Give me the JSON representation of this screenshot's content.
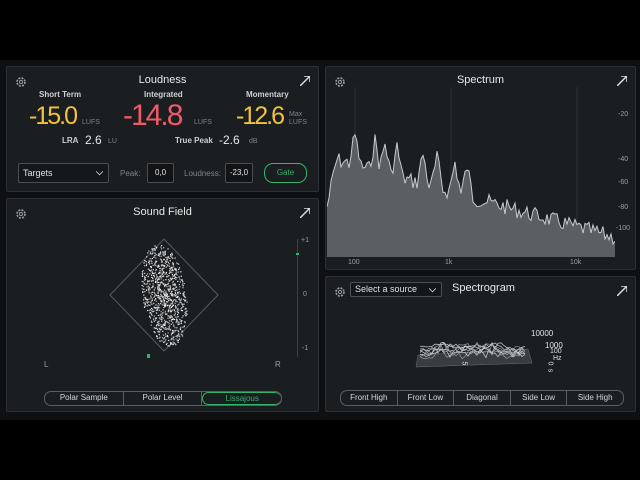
{
  "loudness": {
    "title": "Loudness",
    "short_term": {
      "label": "Short Term",
      "value": "-15.0",
      "unit": "LUFS"
    },
    "integrated": {
      "label": "Integrated",
      "value": "-14.8",
      "unit": "LUFS"
    },
    "momentary": {
      "label": "Momentary",
      "value": "-12.6",
      "unit1": "Max",
      "unit2": "LUFS"
    },
    "lra": {
      "label": "LRA",
      "value": "2.6",
      "unit": "LU"
    },
    "true_peak": {
      "label": "True Peak",
      "value": "-2.6",
      "unit": "dB"
    },
    "targets": "Targets",
    "peak_label": "Peak:",
    "peak_value": "0,0",
    "loudness_label": "Loudness:",
    "loudness_value": "-23,0",
    "gate": "Gate"
  },
  "spectrum": {
    "title": "Spectrum",
    "x_ticks": [
      "100",
      "1k",
      "10k"
    ],
    "y_ticks": [
      "-20",
      "-40",
      "-60",
      "-80",
      "-100"
    ]
  },
  "sound_field": {
    "title": "Sound Field",
    "left": "L",
    "right": "R",
    "scale": [
      "+1",
      "0",
      "-1"
    ],
    "modes": [
      "Polar Sample",
      "Polar Level",
      "Lissajous"
    ],
    "active_mode": "Lissajous"
  },
  "spectrogram": {
    "title": "Spectrogram",
    "source": "Select a source",
    "freq_labels": [
      "10000",
      "1000",
      "100",
      "Hz"
    ],
    "time_labels": [
      "5",
      "0",
      "s"
    ],
    "views": [
      "Front High",
      "Front Low",
      "Diagonal",
      "Side Low",
      "Side High"
    ]
  },
  "colors": {
    "accent": "#34b46a",
    "yellow": "#f4c23a",
    "red": "#f05a66"
  }
}
